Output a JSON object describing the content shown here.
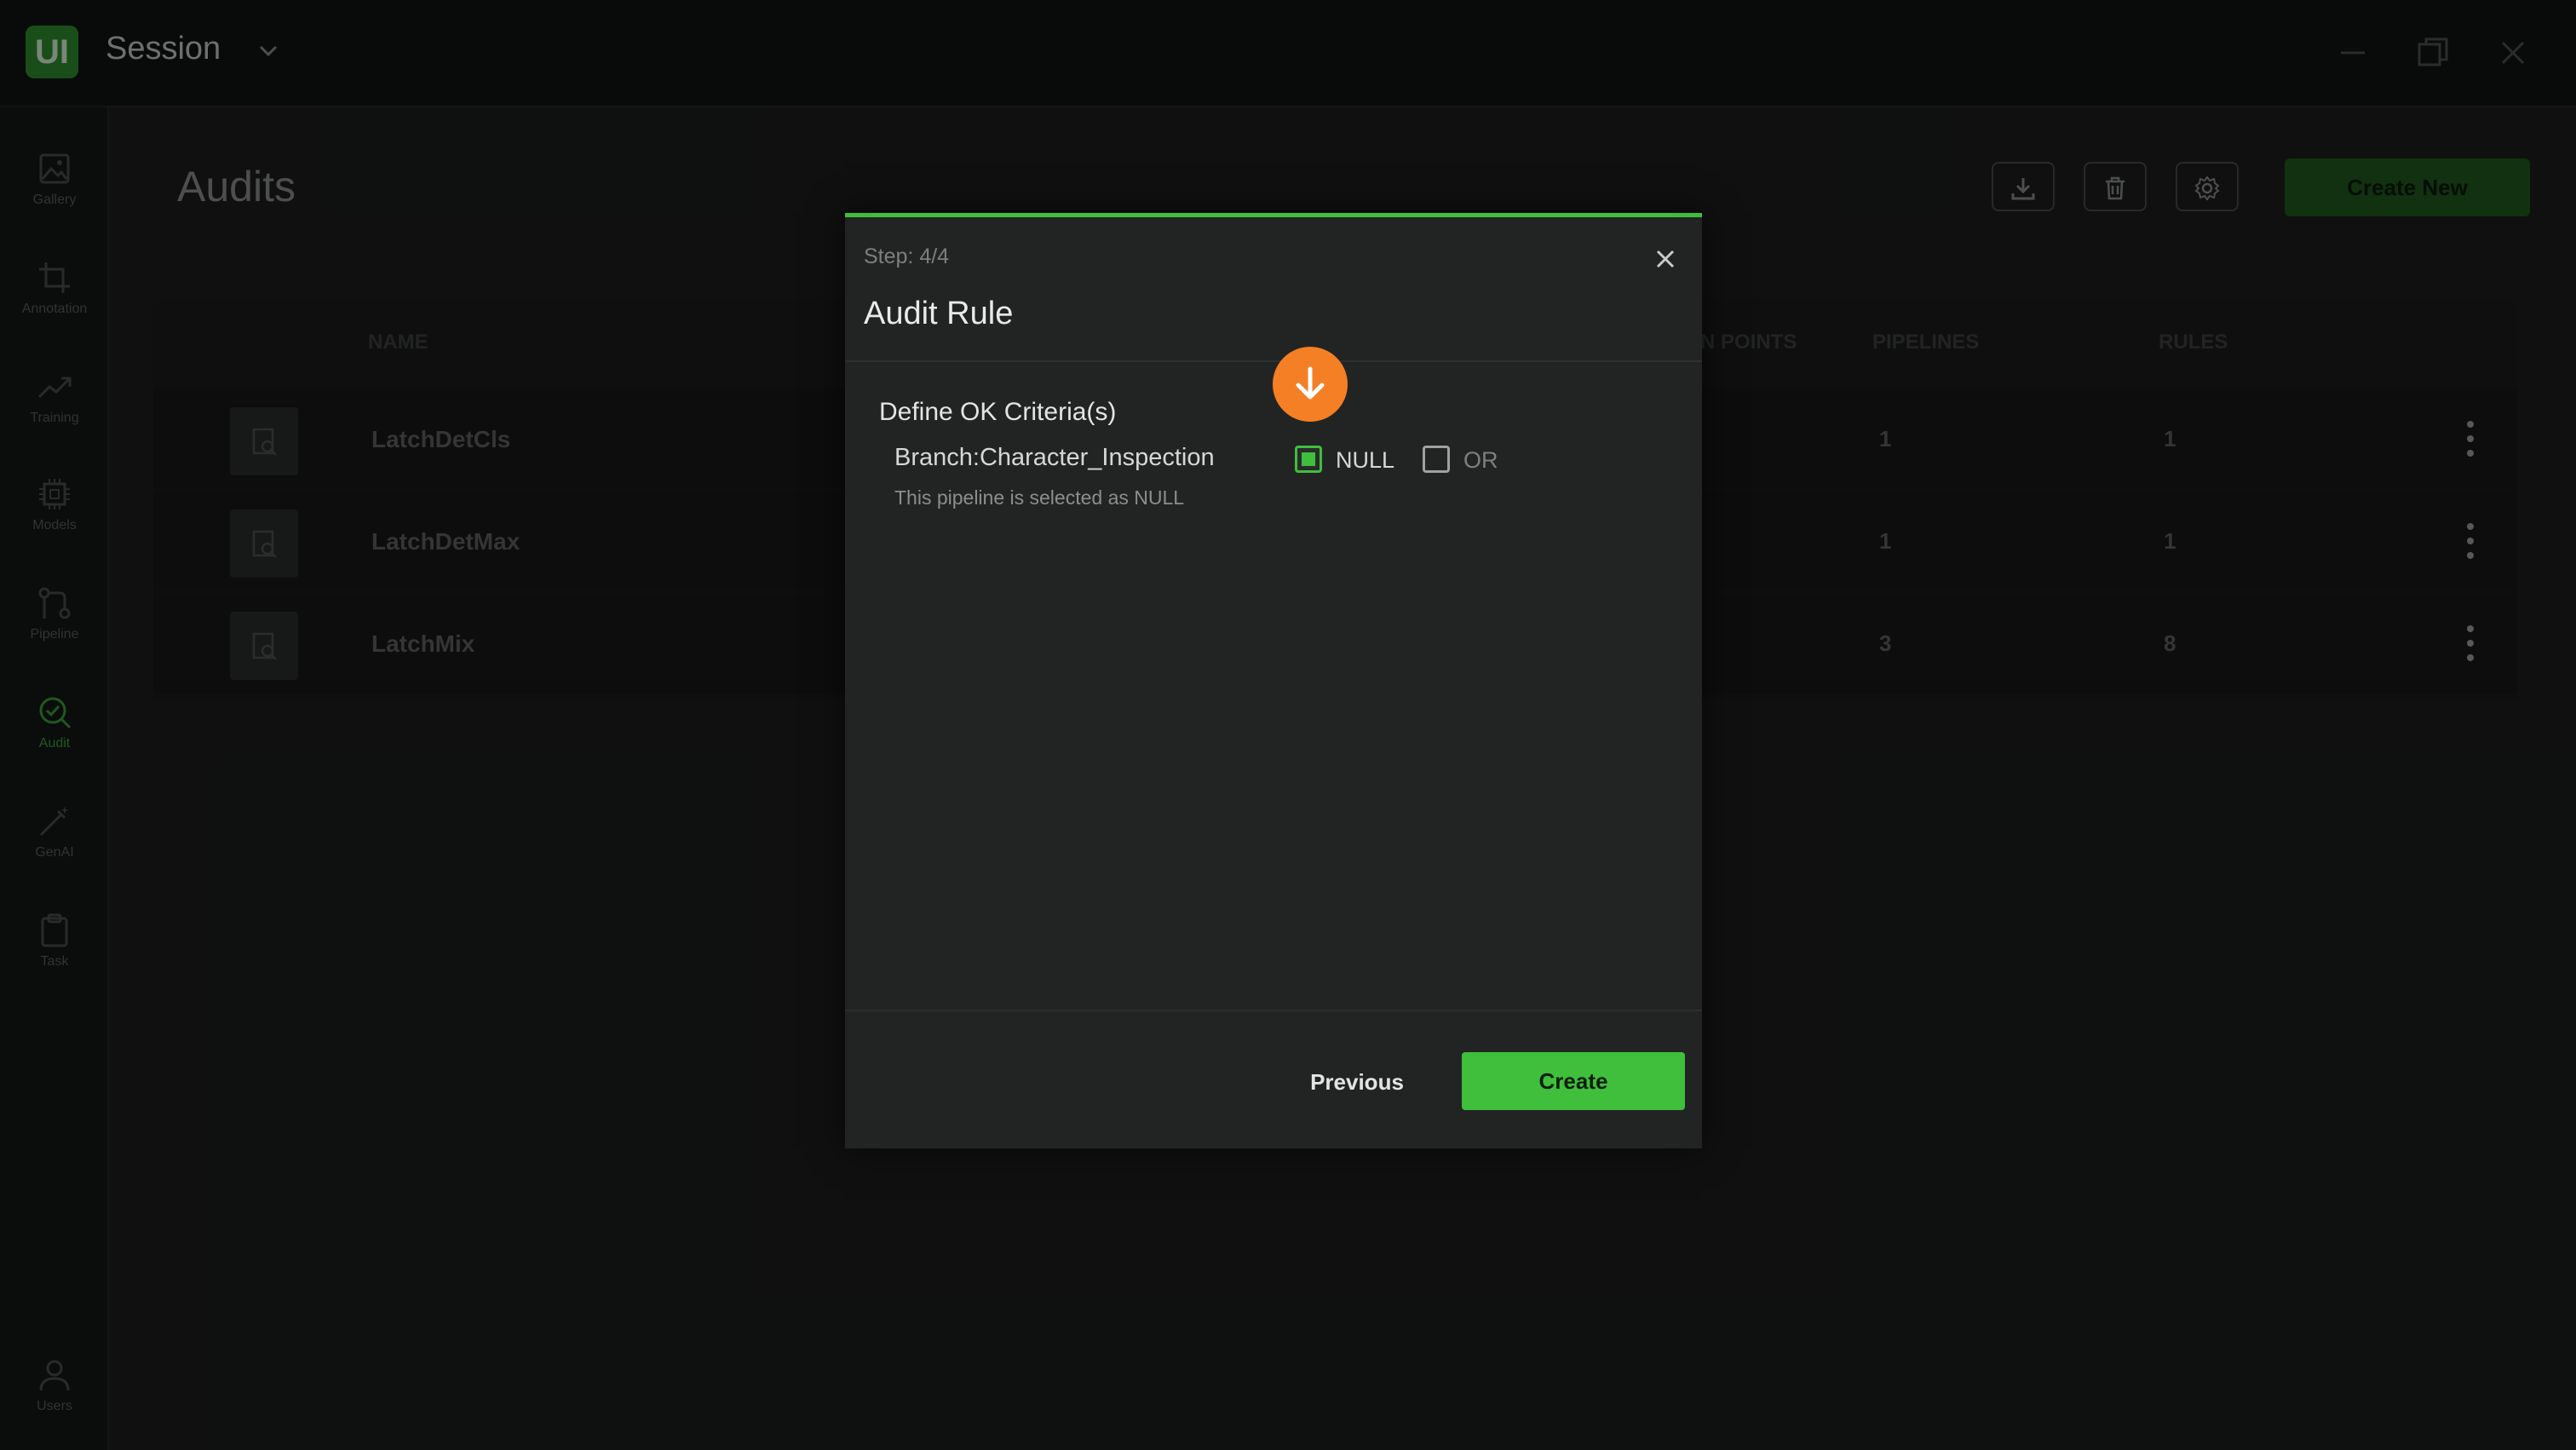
{
  "app": {
    "logo": "UI",
    "session_label": "Session"
  },
  "sidebar": {
    "items": [
      {
        "label": "Gallery",
        "icon": "image-icon"
      },
      {
        "label": "Annotation",
        "icon": "crop-icon"
      },
      {
        "label": "Training",
        "icon": "trend-icon"
      },
      {
        "label": "Models",
        "icon": "chip-icon"
      },
      {
        "label": "Pipeline",
        "icon": "pipeline-icon"
      },
      {
        "label": "Audit",
        "icon": "audit-icon",
        "active": true
      },
      {
        "label": "GenAI",
        "icon": "wand-icon"
      },
      {
        "label": "Task",
        "icon": "clipboard-icon"
      }
    ],
    "bottom": {
      "label": "Users",
      "icon": "user-icon"
    }
  },
  "page": {
    "title": "Audits",
    "create_new_label": "Create New",
    "columns": {
      "name": "NAME",
      "points": "N POINTS",
      "pipelines": "PIPELINES",
      "rules": "RULES"
    },
    "rows": [
      {
        "name": "LatchDetCls",
        "pipelines": "1",
        "rules": "1"
      },
      {
        "name": "LatchDetMax",
        "pipelines": "1",
        "rules": "1"
      },
      {
        "name": "LatchMix",
        "pipelines": "3",
        "rules": "8"
      }
    ]
  },
  "modal": {
    "step": "Step: 4/4",
    "title": "Audit Rule",
    "section_title": "Define OK Criteria(s)",
    "branch": "Branch:Character_Inspection",
    "option_null": "NULL",
    "option_or": "OR",
    "null_checked": true,
    "or_checked": false,
    "hint": "This pipeline is selected as NULL",
    "previous_label": "Previous",
    "create_label": "Create"
  },
  "colors": {
    "accent": "#3fbf3c",
    "pointer": "#f57f25"
  }
}
